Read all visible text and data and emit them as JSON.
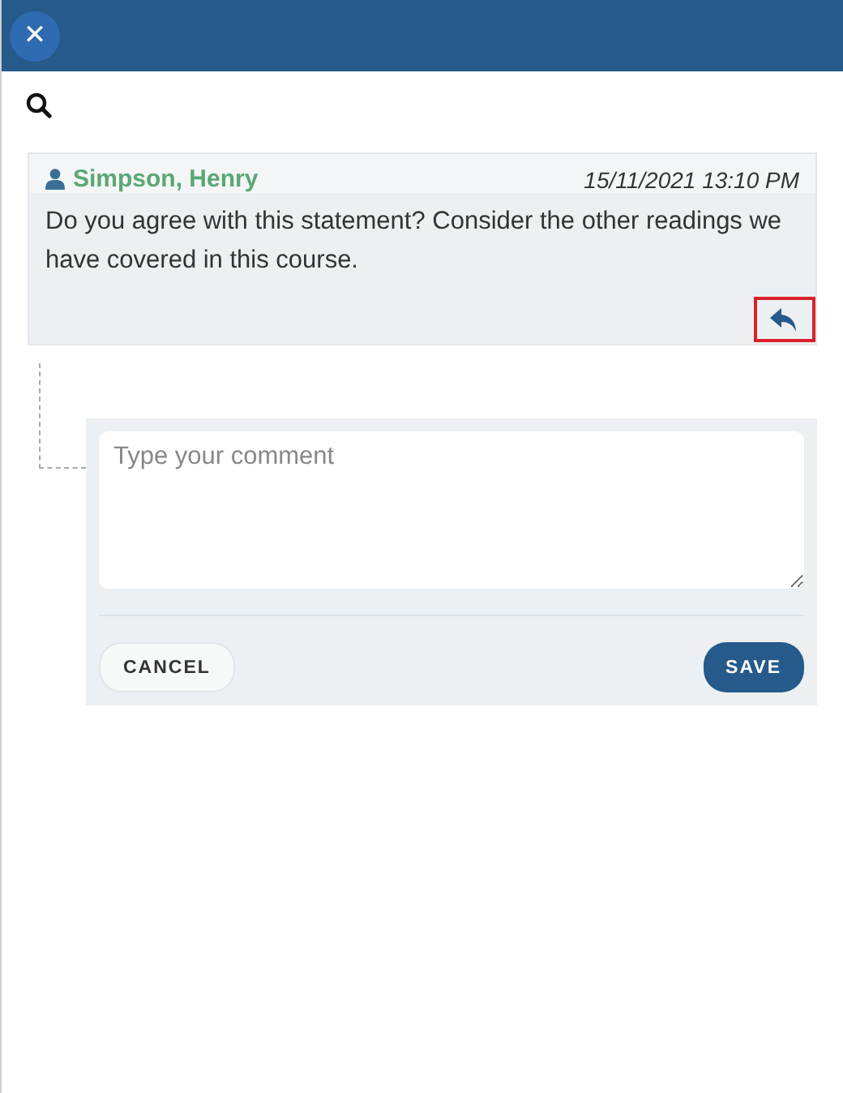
{
  "header": {
    "close_label": "✕"
  },
  "comment": {
    "author": "Simpson, Henry",
    "timestamp": "15/11/2021 13:10 PM",
    "text": "Do you agree with this statement? Consider the other readings we have covered in this course.",
    "reply_highlighted": true
  },
  "reply_form": {
    "placeholder": "Type your comment",
    "buttons": [
      {
        "kind": "secondary",
        "label": "CANCEL"
      },
      {
        "kind": "primary",
        "label": "SAVE"
      }
    ]
  }
}
